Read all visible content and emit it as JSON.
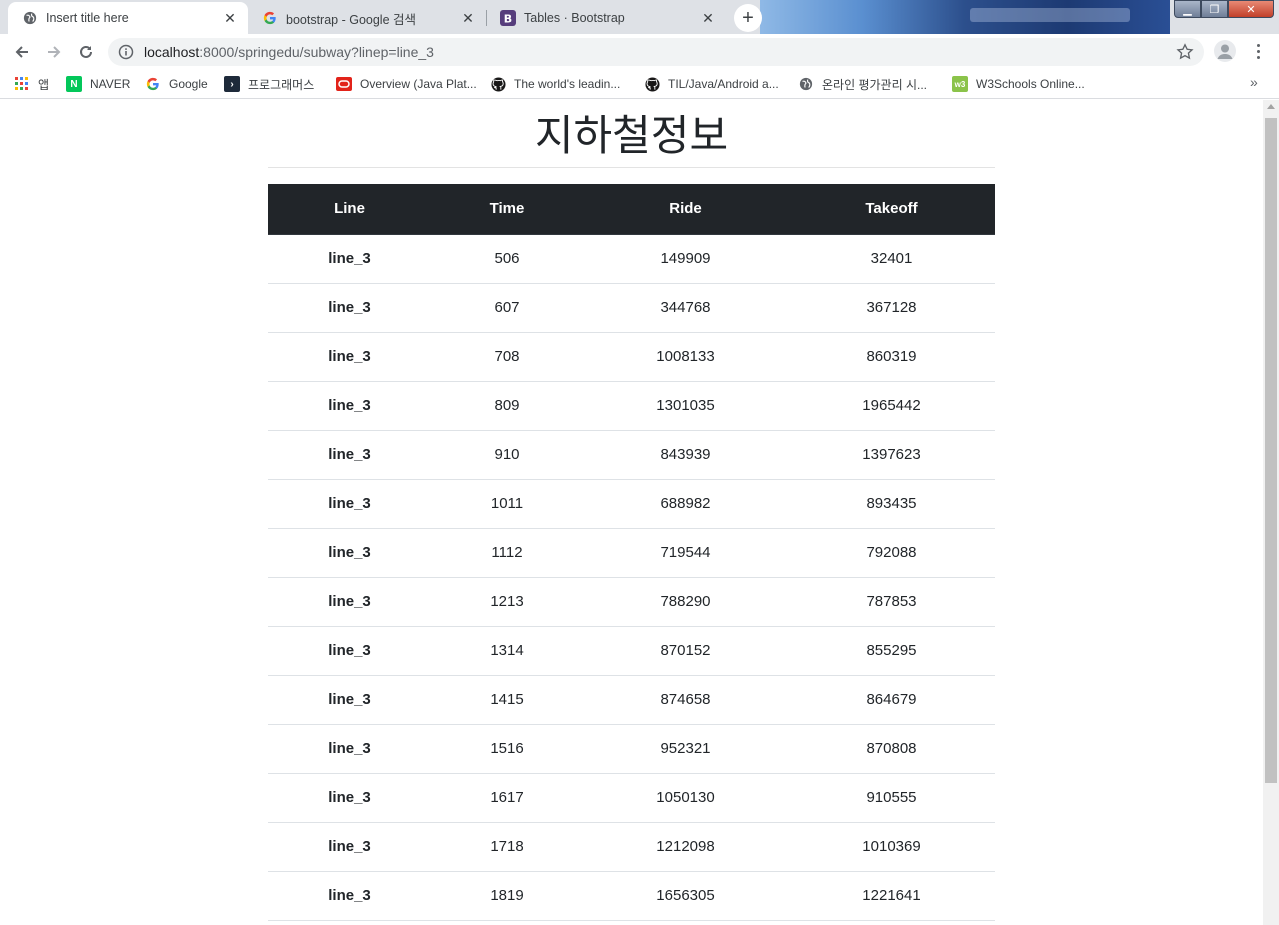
{
  "browser": {
    "tabs": [
      {
        "title": "Insert title here",
        "active": true,
        "icon": "globe-icon"
      },
      {
        "title": "bootstrap - Google 검색",
        "active": false,
        "icon": "google-icon"
      },
      {
        "title": "Tables · Bootstrap",
        "active": false,
        "icon": "bootstrap-icon"
      }
    ],
    "url_host": "localhost",
    "url_path": ":8000/springedu/subway?linep=line_3",
    "bookmarks": [
      {
        "label": "앱",
        "icon": "apps-grid-icon"
      },
      {
        "label": "NAVER",
        "icon": "naver-icon"
      },
      {
        "label": "Google",
        "icon": "google-icon"
      },
      {
        "label": "프로그래머스",
        "icon": "programmers-icon"
      },
      {
        "label": "Overview (Java Plat...",
        "icon": "oracle-icon"
      },
      {
        "label": "The world's leadin...",
        "icon": "github-icon"
      },
      {
        "label": "TIL/Java/Android a...",
        "icon": "github-icon"
      },
      {
        "label": "온라인 평가관리 시...",
        "icon": "globe-icon"
      },
      {
        "label": "W3Schools Online...",
        "icon": "w3schools-icon"
      }
    ],
    "bookmarks_more": "»"
  },
  "page": {
    "heading": "지하철정보",
    "table": {
      "headers": [
        "Line",
        "Time",
        "Ride",
        "Takeoff"
      ],
      "rows": [
        [
          "line_3",
          "506",
          "149909",
          "32401"
        ],
        [
          "line_3",
          "607",
          "344768",
          "367128"
        ],
        [
          "line_3",
          "708",
          "1008133",
          "860319"
        ],
        [
          "line_3",
          "809",
          "1301035",
          "1965442"
        ],
        [
          "line_3",
          "910",
          "843939",
          "1397623"
        ],
        [
          "line_3",
          "1011",
          "688982",
          "893435"
        ],
        [
          "line_3",
          "1112",
          "719544",
          "792088"
        ],
        [
          "line_3",
          "1213",
          "788290",
          "787853"
        ],
        [
          "line_3",
          "1314",
          "870152",
          "855295"
        ],
        [
          "line_3",
          "1415",
          "874658",
          "864679"
        ],
        [
          "line_3",
          "1516",
          "952321",
          "870808"
        ],
        [
          "line_3",
          "1617",
          "1050130",
          "910555"
        ],
        [
          "line_3",
          "1718",
          "1212098",
          "1010369"
        ],
        [
          "line_3",
          "1819",
          "1656305",
          "1221641"
        ]
      ]
    }
  }
}
